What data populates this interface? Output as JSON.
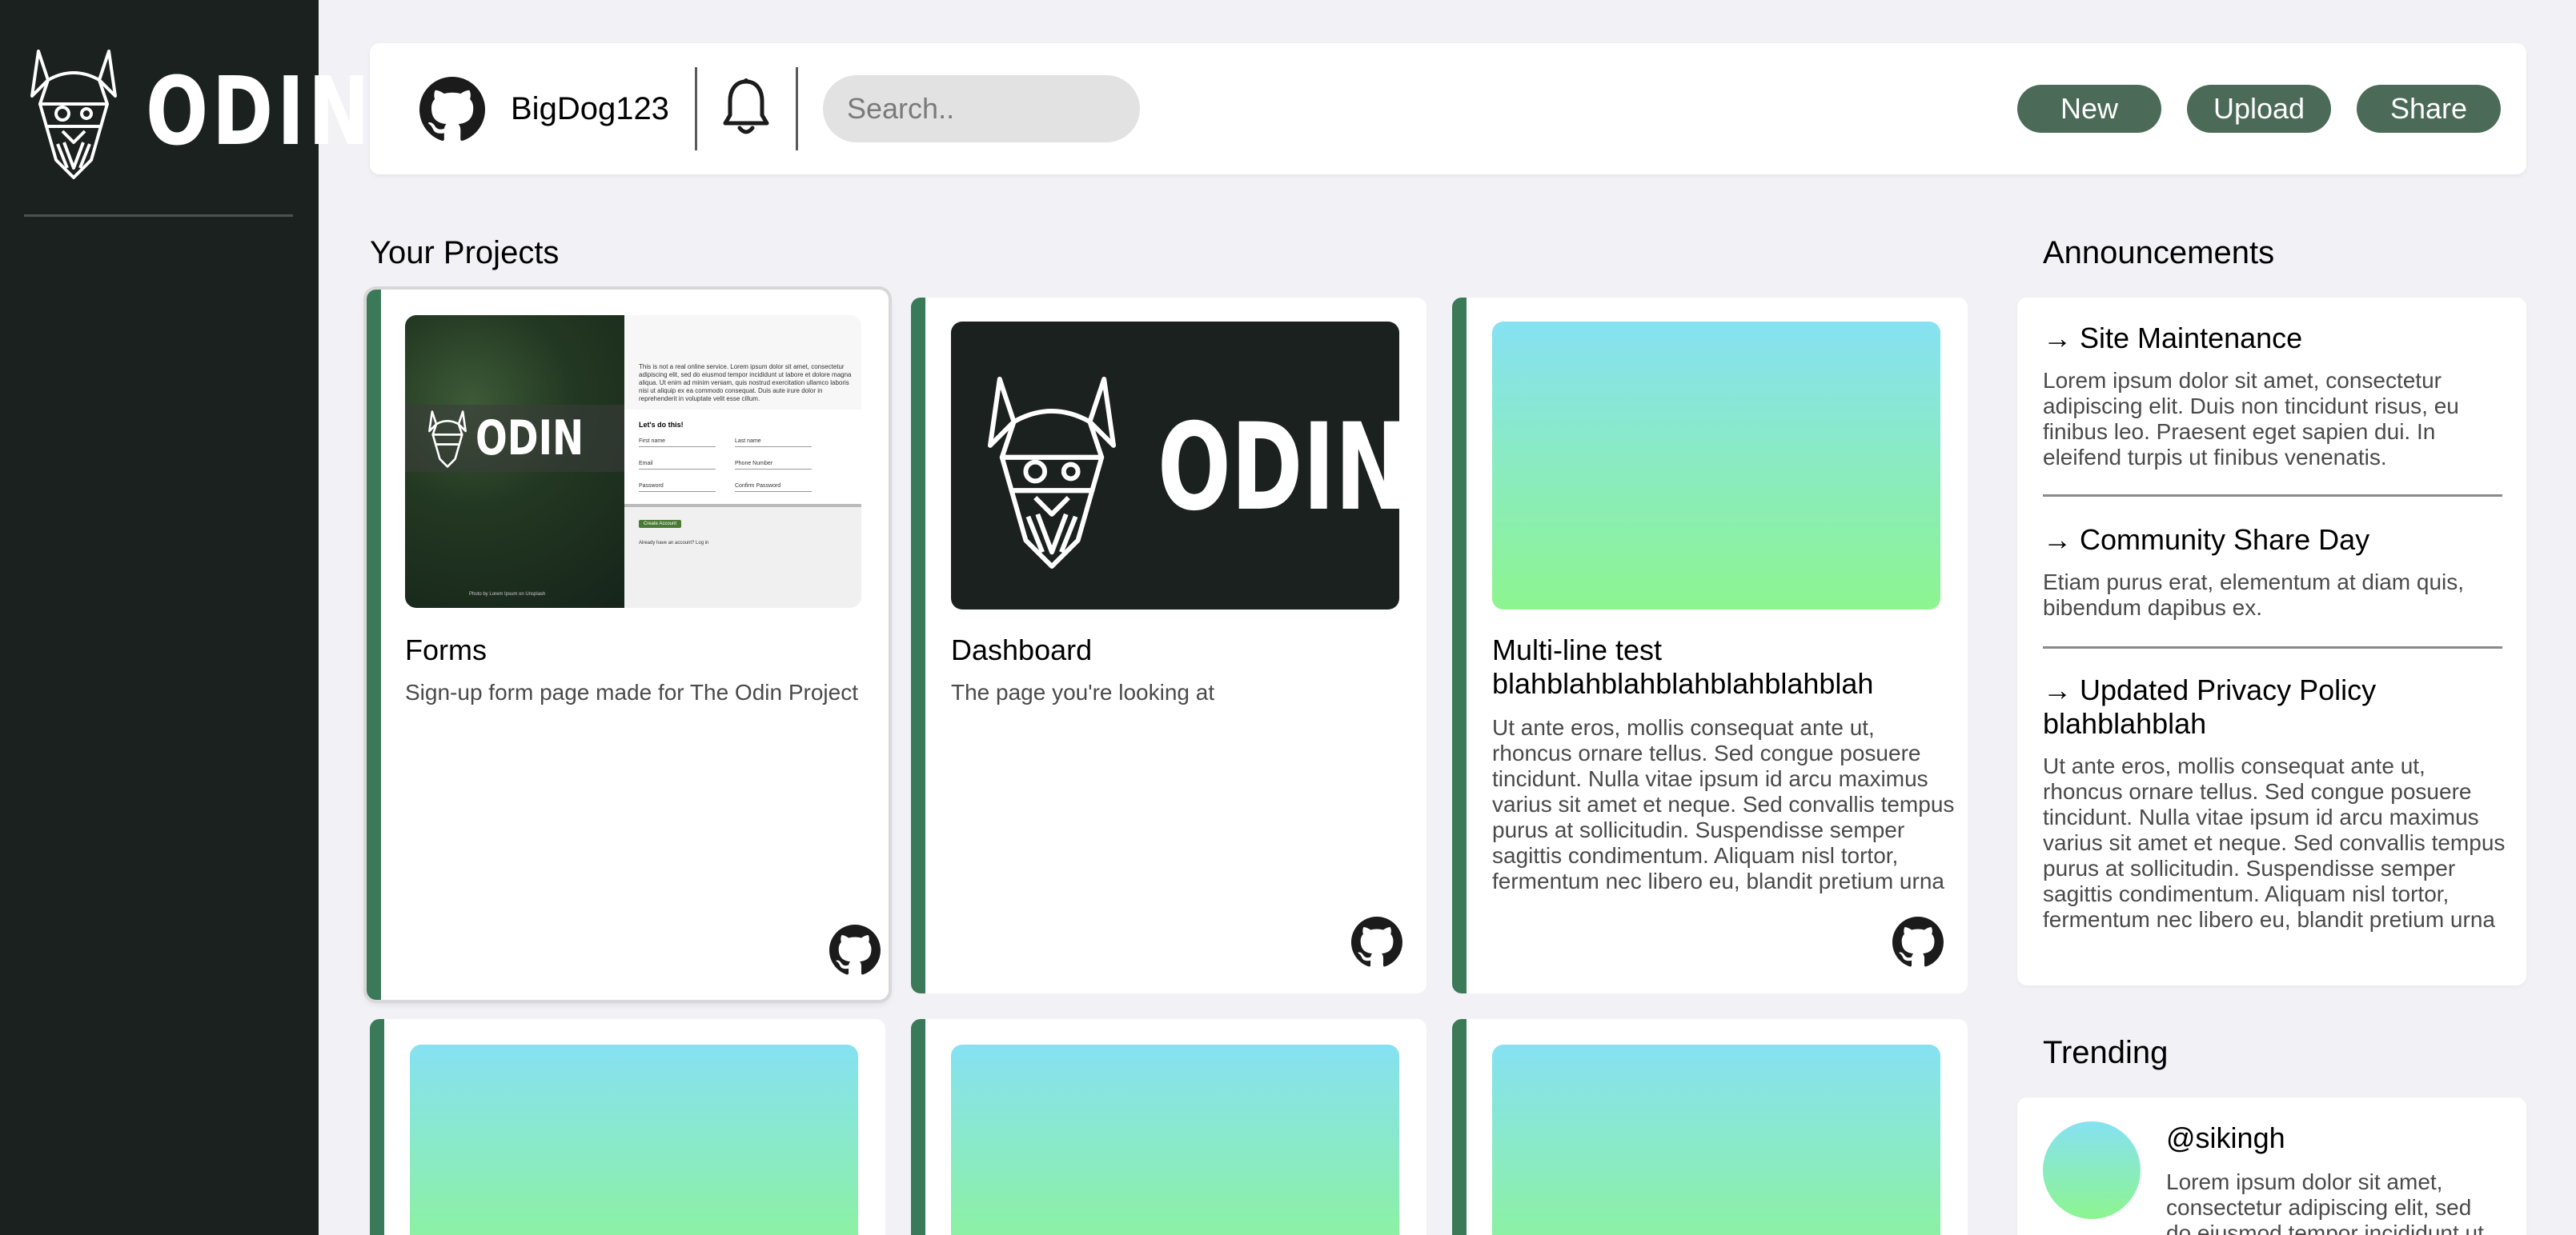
{
  "brand": {
    "name": "ODIN"
  },
  "header": {
    "username": "BigDog123",
    "search_placeholder": "Search..",
    "buttons": {
      "new": "New",
      "upload": "Upload",
      "share": "Share"
    }
  },
  "projects": {
    "title": "Your Projects",
    "items": [
      {
        "title": "Forms",
        "description": "Sign-up form page made for The Odin Project"
      },
      {
        "title": "Dashboard",
        "description": "The page you're looking at"
      },
      {
        "title": "Multi-line test blahblahblahblahblahblahblah",
        "description": "Ut ante eros, mollis consequat ante ut, rhoncus ornare tellus. Sed congue posuere tincidunt. Nulla vitae ipsum id arcu maximus varius sit amet et neque. Sed convallis tempus purus at sollicitudin. Suspendisse semper sagittis condimentum. Aliquam nisl tortor, fermentum nec libero eu, blandit pretium urna"
      }
    ]
  },
  "forms_preview": {
    "intro": "This is not a real online service. Lorem ipsum dolor sit amet, consectetur adipiscing elit, sed do eiusmod tempor incididunt ut labore et dolore magna aliqua. Ut enim ad minim veniam, quis nostrud exercitation ullamco laboris nisi ut aliquip ex ea commodo consequat. Duis aute irure dolor in reprehenderit in voluptate velit esse cillum.",
    "heading": "Let's do this!",
    "fields": [
      "First name",
      "Last name",
      "Email",
      "Phone Number",
      "Password",
      "Confirm Password"
    ],
    "button": "Create Account",
    "footer": "Already have an account? Log in",
    "photo_credit": "Photo by Lorem Ipsum on Unsplash"
  },
  "announcements": {
    "title": "Announcements",
    "items": [
      {
        "title": "→ Site Maintenance",
        "body": "Lorem ipsum dolor sit amet, consectetur adipiscing elit. Duis non tincidunt risus, eu finibus leo. Praesent eget sapien dui. In eleifend turpis ut finibus venenatis."
      },
      {
        "title": "→ Community Share Day",
        "body": "Etiam purus erat, elementum at diam quis, bibendum dapibus ex."
      },
      {
        "title": "→ Updated Privacy Policy blahblahblah",
        "body": "Ut ante eros, mollis consequat ante ut, rhoncus ornare tellus. Sed congue posuere tincidunt. Nulla vitae ipsum id arcu maximus varius sit amet et neque. Sed convallis tempus purus at sollicitudin. Suspendisse semper sagittis condimentum. Aliquam nisl tortor, fermentum nec libero eu, blandit pretium urna"
      }
    ]
  },
  "trending": {
    "title": "Trending",
    "items": [
      {
        "handle": "@sikingh",
        "body": "Lorem ipsum dolor sit amet, consectetur adipiscing elit, sed do eiusmod tempor incididunt ut"
      }
    ]
  },
  "colors": {
    "sidebar": "#1b211f",
    "accent": "#3a7a58",
    "button": "#4b6b58",
    "background": "#f2f2f6"
  }
}
